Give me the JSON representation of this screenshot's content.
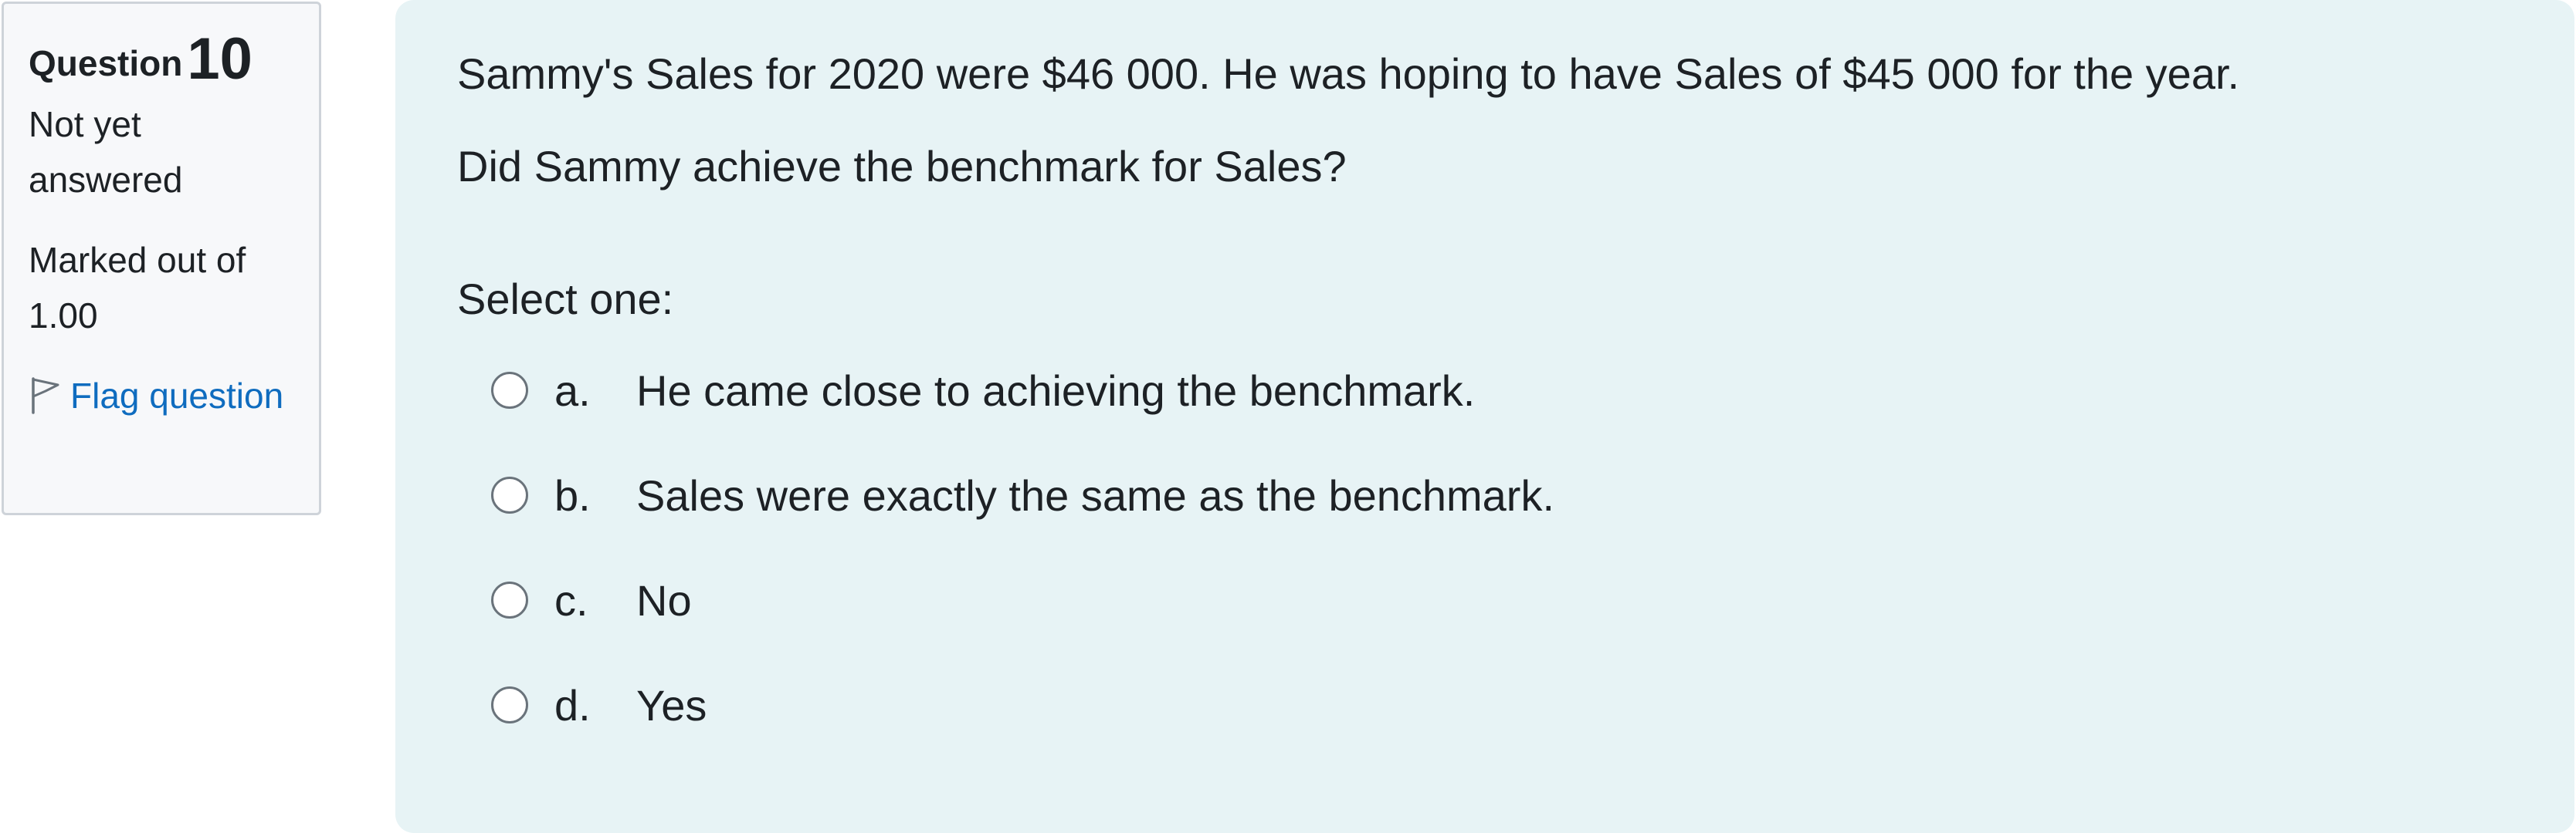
{
  "info": {
    "question_label": "Question",
    "question_number": "10",
    "state": "Not yet answered",
    "grade": "Marked out of 1.00",
    "flag_label": "Flag question"
  },
  "question": {
    "text_1": "Sammy's Sales for 2020 were $46 000. He was hoping to have Sales of $45 000 for the year.",
    "text_2": "Did Sammy achieve the benchmark for Sales?",
    "prompt": "Select one:",
    "options": [
      {
        "letter": "a.",
        "text": "He came close to achieving the benchmark."
      },
      {
        "letter": "b.",
        "text": "Sales were exactly the same as the benchmark."
      },
      {
        "letter": "c.",
        "text": "No"
      },
      {
        "letter": "d.",
        "text": "Yes"
      }
    ]
  },
  "icons": {
    "flag": "flag-icon",
    "radio": "radio-unchecked"
  },
  "colors": {
    "info_background": "#f7f8fa",
    "content_background": "#e7f3f5",
    "link": "#0f6cbf",
    "text": "#1d2125"
  }
}
